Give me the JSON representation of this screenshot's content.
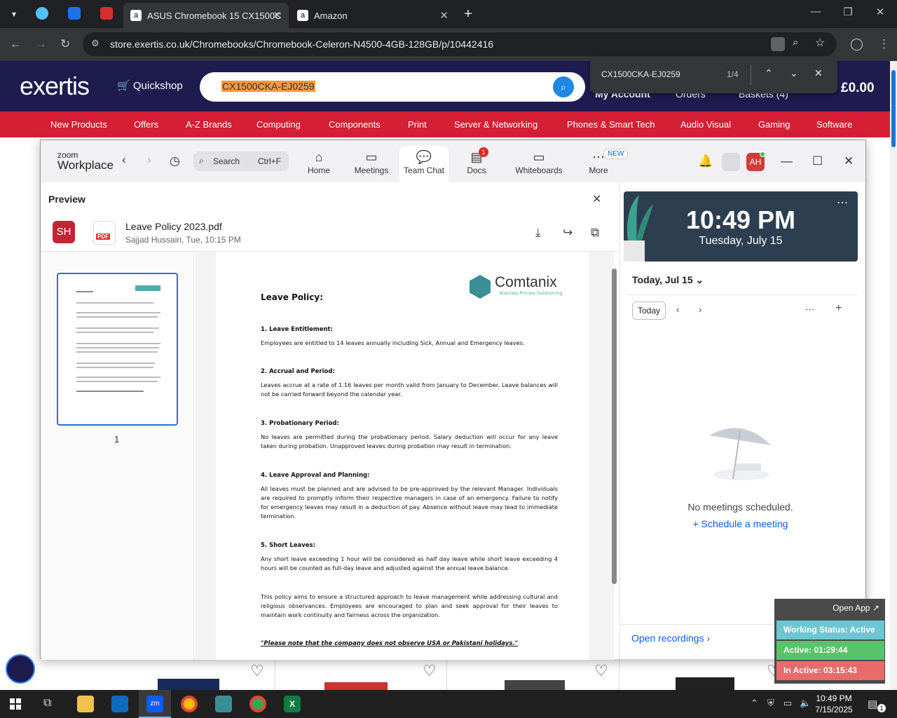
{
  "browser": {
    "tabs": [
      {
        "label": "ASUS Chromebook 15 CX1500C"
      },
      {
        "label": "Amazon"
      }
    ],
    "url": "store.exertis.co.uk/Chromebooks/Chromebook-Celeron-N4500-4GB-128GB/p/10442416",
    "find": {
      "term": "CX1500CKA-EJ0259",
      "count": "1/4"
    }
  },
  "site": {
    "logo": "exertis",
    "quickshop": "Quickshop",
    "search_value": "CX1500CKA-EJ0259",
    "my_account": "My Account",
    "orders": "Orders",
    "baskets": "Baskets (4)",
    "price": "£0.00",
    "categories": [
      "New Products",
      "Offers",
      "A-Z Brands",
      "Computing",
      "Components",
      "Print",
      "Server & Networking",
      "Phones & Smart Tech",
      "Audio Visual",
      "Gaming",
      "Software"
    ]
  },
  "zoom": {
    "logo_top": "zoom",
    "logo_bottom": "Workplace",
    "search_label": "Search",
    "search_shortcut": "Ctrl+F",
    "nav": [
      {
        "label": "Home",
        "icon": "home-icon"
      },
      {
        "label": "Meetings",
        "icon": "video-icon"
      },
      {
        "label": "Team Chat",
        "icon": "chat-icon"
      },
      {
        "label": "Docs",
        "icon": "doc-icon",
        "badge": "1"
      },
      {
        "label": "Whiteboards",
        "icon": "whiteboard-icon"
      },
      {
        "label": "More",
        "icon": "more-icon",
        "badge": "NEW"
      }
    ],
    "avatar": "AH"
  },
  "preview": {
    "title": "Preview",
    "sender_initials": "SH",
    "pdf_label": "PDF",
    "file_name": "Leave Policy 2023.pdf",
    "file_meta": "Sajjad Hussain, Tue, 10:15 PM",
    "page_number": "1",
    "doc": {
      "company": "Comtanix",
      "tagline": "Business Process Outsourcing",
      "title": "Leave Policy:",
      "sections": [
        {
          "heading": "1. Leave Entitlement:",
          "text": "Employees are entitled to 14 leaves annually including Sick, Annual and Emergency leaves."
        },
        {
          "heading": "2. Accrual and Period:",
          "text": "Leaves accrue at a rate of 1.16 leaves per month valid from January to December. Leave balances will not be carried forward beyond the calendar year."
        },
        {
          "heading": "3. Probationary Period:",
          "text": "No leaves are permitted during the probationary period. Salary deduction will occur for any leave taken during probation. Unapproved leaves during probation may result in termination."
        },
        {
          "heading": "4. Leave Approval and Planning:",
          "text": "All leaves must be planned and are advised to be pre-approved by the relevant Manager. Individuals are required to promptly inform their respective managers in case of an emergency. Failure to notify for emergency leaves may result in a deduction of pay. Absence without leave may lead to immediate termination."
        },
        {
          "heading": "5. Short Leaves:",
          "text": "Any short leave exceeding 1 hour will be considered as half day leave while short leave exceeding 4 hours will be counted as full-day leave and adjusted against the annual leave balance."
        }
      ],
      "closing": "This policy aims to ensure a structured approach to leave management while addressing cultural and religious observances. Employees are encouraged to plan and seek approval for their leaves to maintain work continuity and fairness across the organization.",
      "note": "\"Please note that the company does not observe USA or Pakistani holidays.\""
    }
  },
  "calendar": {
    "time": "10:49 PM",
    "date": "Tuesday, July 15",
    "today_header": "Today, Jul 15",
    "today_button": "Today",
    "empty": "No meetings scheduled.",
    "schedule": "Schedule a meeting",
    "recordings": "Open recordings"
  },
  "status_widget": {
    "open_app": "Open App ↗",
    "working": "Working Status: Active",
    "active": "Active: 01:29:44",
    "inactive": "In Active: 03:15:43"
  },
  "taskbar": {
    "time": "10:49 PM",
    "date": "7/15/2025",
    "notification_count": "1"
  }
}
